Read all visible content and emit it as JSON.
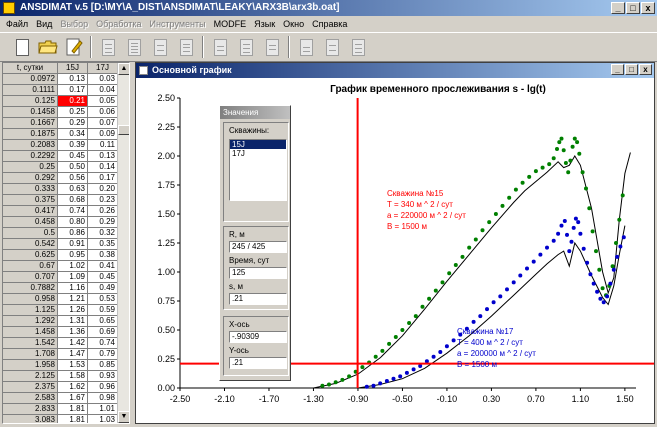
{
  "window": {
    "title": "ANSDIMAT v.5  [D:\\MY\\A_DIST\\ANSDIMAT\\LEAKY\\ARX3B\\arx3b.oat]",
    "min_label": "_",
    "max_label": "□",
    "close_label": "x"
  },
  "menu": [
    {
      "label": "Файл",
      "enabled": true
    },
    {
      "label": "Вид",
      "enabled": true
    },
    {
      "label": "Выбор",
      "enabled": false
    },
    {
      "label": "Обработка",
      "enabled": false
    },
    {
      "label": "Инструменты",
      "enabled": false
    },
    {
      "label": "MODFE",
      "enabled": true
    },
    {
      "label": "Язык",
      "enabled": true
    },
    {
      "label": "Окно",
      "enabled": true
    },
    {
      "label": "Справка",
      "enabled": true
    }
  ],
  "table": {
    "headers": [
      "t, сутки",
      "15J",
      "17J"
    ],
    "rows": [
      [
        "0.0972",
        "0.13",
        "0.03"
      ],
      [
        "0.1111",
        "0.17",
        "0.04"
      ],
      [
        "0.125",
        "0.21",
        "0.05"
      ],
      [
        "0.1458",
        "0.25",
        "0.06"
      ],
      [
        "0.1667",
        "0.29",
        "0.07"
      ],
      [
        "0.1875",
        "0.34",
        "0.09"
      ],
      [
        "0.2083",
        "0.39",
        "0.11"
      ],
      [
        "0.2292",
        "0.45",
        "0.13"
      ],
      [
        "0.25",
        "0.50",
        "0.14"
      ],
      [
        "0.292",
        "0.56",
        "0.17"
      ],
      [
        "0.333",
        "0.63",
        "0.20"
      ],
      [
        "0.375",
        "0.68",
        "0.23"
      ],
      [
        "0.417",
        "0.74",
        "0.26"
      ],
      [
        "0.458",
        "0.80",
        "0.29"
      ],
      [
        "0.5",
        "0.86",
        "0.32"
      ],
      [
        "0.542",
        "0.91",
        "0.35"
      ],
      [
        "0.625",
        "0.95",
        "0.38"
      ],
      [
        "0.67",
        "1.02",
        "0.41"
      ],
      [
        "0.707",
        "1.09",
        "0.45"
      ],
      [
        "0.7882",
        "1.16",
        "0.49"
      ],
      [
        "0.958",
        "1.21",
        "0.53"
      ],
      [
        "1.125",
        "1.26",
        "0.59"
      ],
      [
        "1.292",
        "1.31",
        "0.65"
      ],
      [
        "1.458",
        "1.36",
        "0.69"
      ],
      [
        "1.542",
        "1.42",
        "0.74"
      ],
      [
        "1.708",
        "1.47",
        "0.79"
      ],
      [
        "1.958",
        "1.53",
        "0.85"
      ],
      [
        "2.125",
        "1.58",
        "0.93"
      ],
      [
        "2.375",
        "1.62",
        "0.96"
      ],
      [
        "2.583",
        "1.67",
        "0.98"
      ],
      [
        "2.833",
        "1.81",
        "1.01"
      ],
      [
        "3.083",
        "1.81",
        "1.03"
      ]
    ],
    "selected_cell": {
      "row": 2,
      "col": 1
    }
  },
  "graph_window": {
    "title": "Основной график"
  },
  "values_dialog": {
    "title": "Значения",
    "wells_label": "Скважины:",
    "wells": [
      "15J",
      "17J"
    ],
    "selected_well": "15J",
    "r_label": "R, м",
    "r_value": "245 / 425",
    "time_label": "Время, сут",
    "time_value": "125",
    "s_label": "s, м",
    "s_value": ".21",
    "x_label": "X-ось",
    "x_value": "-.90309",
    "y_label": "Y-ось",
    "y_value": ".21"
  },
  "colors": {
    "well15": "#008000",
    "well17": "#0000cc",
    "cursor": "#ff0000",
    "anno15": "#ff0000",
    "anno17": "#0000cc"
  },
  "chart_data": {
    "type": "scatter",
    "title": "График временного прослеживания s - lg(t)",
    "xlim": [
      -2.5,
      1.6
    ],
    "ylim": [
      0,
      2.5
    ],
    "xticks": [
      "-2.50",
      "-2.10",
      "-1.70",
      "-1.30",
      "-0.90",
      "-0.50",
      "-0.10",
      "0.30",
      "0.70",
      "1.10",
      "1.50"
    ],
    "yticks": [
      "0.00",
      "0.25",
      "0.50",
      "0.75",
      "1.00",
      "1.25",
      "1.50",
      "1.75",
      "2.00",
      "2.25",
      "2.50"
    ],
    "cursor": {
      "x": -0.90309,
      "y": 0.21
    },
    "series": [
      {
        "name": "Скважина №15",
        "points": [
          [
            -1.22,
            0.02
          ],
          [
            -1.16,
            0.03
          ],
          [
            -1.1,
            0.05
          ],
          [
            -1.04,
            0.07
          ],
          [
            -0.98,
            0.1
          ],
          [
            -0.92,
            0.14
          ],
          [
            -0.86,
            0.18
          ],
          [
            -0.8,
            0.22
          ],
          [
            -0.74,
            0.27
          ],
          [
            -0.68,
            0.32
          ],
          [
            -0.62,
            0.38
          ],
          [
            -0.56,
            0.44
          ],
          [
            -0.5,
            0.5
          ],
          [
            -0.44,
            0.56
          ],
          [
            -0.38,
            0.62
          ],
          [
            -0.32,
            0.7
          ],
          [
            -0.26,
            0.77
          ],
          [
            -0.2,
            0.84
          ],
          [
            -0.14,
            0.91
          ],
          [
            -0.08,
            0.99
          ],
          [
            -0.02,
            1.06
          ],
          [
            0.04,
            1.13
          ],
          [
            0.1,
            1.21
          ],
          [
            0.16,
            1.28
          ],
          [
            0.22,
            1.36
          ],
          [
            0.28,
            1.43
          ],
          [
            0.34,
            1.5
          ],
          [
            0.4,
            1.57
          ],
          [
            0.46,
            1.64
          ],
          [
            0.52,
            1.71
          ],
          [
            0.58,
            1.77
          ],
          [
            0.64,
            1.82
          ],
          [
            0.7,
            1.87
          ],
          [
            0.76,
            1.9
          ],
          [
            0.82,
            1.93
          ],
          [
            0.86,
            1.98
          ],
          [
            0.89,
            2.06
          ],
          [
            0.91,
            2.12
          ],
          [
            0.93,
            2.15
          ],
          [
            0.95,
            2.05
          ],
          [
            0.97,
            1.94
          ],
          [
            0.99,
            1.86
          ],
          [
            1.01,
            1.96
          ],
          [
            1.03,
            2.08
          ],
          [
            1.05,
            2.15
          ],
          [
            1.07,
            2.12
          ],
          [
            1.09,
            2.02
          ],
          [
            1.12,
            1.86
          ],
          [
            1.15,
            1.72
          ],
          [
            1.18,
            1.55
          ],
          [
            1.21,
            1.35
          ],
          [
            1.24,
            1.18
          ],
          [
            1.27,
            1.02
          ],
          [
            1.3,
            0.86
          ],
          [
            1.33,
            0.8
          ],
          [
            1.36,
            0.88
          ],
          [
            1.39,
            1.05
          ],
          [
            1.42,
            1.25
          ],
          [
            1.45,
            1.45
          ],
          [
            1.48,
            1.66
          ]
        ],
        "theory": [
          [
            -1.3,
            0.0
          ],
          [
            -1.1,
            0.04
          ],
          [
            -0.9,
            0.12
          ],
          [
            -0.7,
            0.26
          ],
          [
            -0.5,
            0.45
          ],
          [
            -0.3,
            0.68
          ],
          [
            -0.1,
            0.92
          ],
          [
            0.1,
            1.15
          ],
          [
            0.3,
            1.38
          ],
          [
            0.5,
            1.6
          ],
          [
            0.6,
            1.7
          ],
          [
            0.7,
            1.78
          ],
          [
            0.8,
            1.86
          ],
          [
            0.9,
            1.95
          ],
          [
            0.95,
            1.9
          ],
          [
            1.0,
            1.92
          ],
          [
            1.05,
            2.0
          ],
          [
            1.1,
            1.92
          ],
          [
            1.2,
            1.55
          ],
          [
            1.3,
            1.0
          ],
          [
            1.35,
            0.82
          ],
          [
            1.4,
            0.95
          ],
          [
            1.45,
            1.45
          ],
          [
            1.5,
            1.85
          ],
          [
            1.55,
            2.03
          ]
        ]
      },
      {
        "name": "Скважина №17",
        "points": [
          [
            -0.82,
            0.01
          ],
          [
            -0.76,
            0.02
          ],
          [
            -0.7,
            0.04
          ],
          [
            -0.64,
            0.06
          ],
          [
            -0.58,
            0.08
          ],
          [
            -0.52,
            0.1
          ],
          [
            -0.46,
            0.13
          ],
          [
            -0.4,
            0.16
          ],
          [
            -0.34,
            0.19
          ],
          [
            -0.28,
            0.23
          ],
          [
            -0.22,
            0.27
          ],
          [
            -0.16,
            0.31
          ],
          [
            -0.1,
            0.36
          ],
          [
            -0.04,
            0.41
          ],
          [
            0.02,
            0.46
          ],
          [
            0.08,
            0.51
          ],
          [
            0.14,
            0.57
          ],
          [
            0.2,
            0.62
          ],
          [
            0.26,
            0.68
          ],
          [
            0.32,
            0.74
          ],
          [
            0.38,
            0.79
          ],
          [
            0.44,
            0.85
          ],
          [
            0.5,
            0.91
          ],
          [
            0.56,
            0.97
          ],
          [
            0.62,
            1.03
          ],
          [
            0.68,
            1.09
          ],
          [
            0.74,
            1.15
          ],
          [
            0.8,
            1.21
          ],
          [
            0.86,
            1.27
          ],
          [
            0.9,
            1.33
          ],
          [
            0.93,
            1.4
          ],
          [
            0.96,
            1.44
          ],
          [
            0.98,
            1.32
          ],
          [
            1.0,
            1.18
          ],
          [
            1.02,
            1.26
          ],
          [
            1.04,
            1.38
          ],
          [
            1.06,
            1.46
          ],
          [
            1.08,
            1.43
          ],
          [
            1.1,
            1.33
          ],
          [
            1.13,
            1.2
          ],
          [
            1.16,
            1.08
          ],
          [
            1.19,
            0.98
          ],
          [
            1.22,
            0.9
          ],
          [
            1.25,
            0.83
          ],
          [
            1.28,
            0.77
          ],
          [
            1.31,
            0.74
          ],
          [
            1.34,
            0.79
          ],
          [
            1.37,
            0.9
          ],
          [
            1.4,
            1.02
          ],
          [
            1.43,
            1.13
          ],
          [
            1.46,
            1.22
          ],
          [
            1.49,
            1.3
          ]
        ],
        "theory": [
          [
            -0.9,
            0.0
          ],
          [
            -0.7,
            0.03
          ],
          [
            -0.5,
            0.08
          ],
          [
            -0.3,
            0.17
          ],
          [
            -0.1,
            0.3
          ],
          [
            0.1,
            0.45
          ],
          [
            0.3,
            0.62
          ],
          [
            0.5,
            0.8
          ],
          [
            0.7,
            0.98
          ],
          [
            0.8,
            1.07
          ],
          [
            0.9,
            1.15
          ],
          [
            0.95,
            1.18
          ],
          [
            1.0,
            1.05
          ],
          [
            1.05,
            1.25
          ],
          [
            1.1,
            1.18
          ],
          [
            1.2,
            0.97
          ],
          [
            1.3,
            0.78
          ],
          [
            1.35,
            0.72
          ],
          [
            1.4,
            0.88
          ],
          [
            1.45,
            1.15
          ],
          [
            1.5,
            1.4
          ]
        ]
      }
    ],
    "annotations": [
      {
        "well": "Скважина №15",
        "lines": [
          "T = 340  м ^ 2 / сут",
          "a = 220000  м ^ 2 / сут",
          "B = 1500  м"
        ]
      },
      {
        "well": "Скважина №17",
        "lines": [
          "T = 400  м ^ 2 / сут",
          "a = 200000  м ^ 2 / сут",
          "B = 1500  м"
        ]
      }
    ]
  }
}
